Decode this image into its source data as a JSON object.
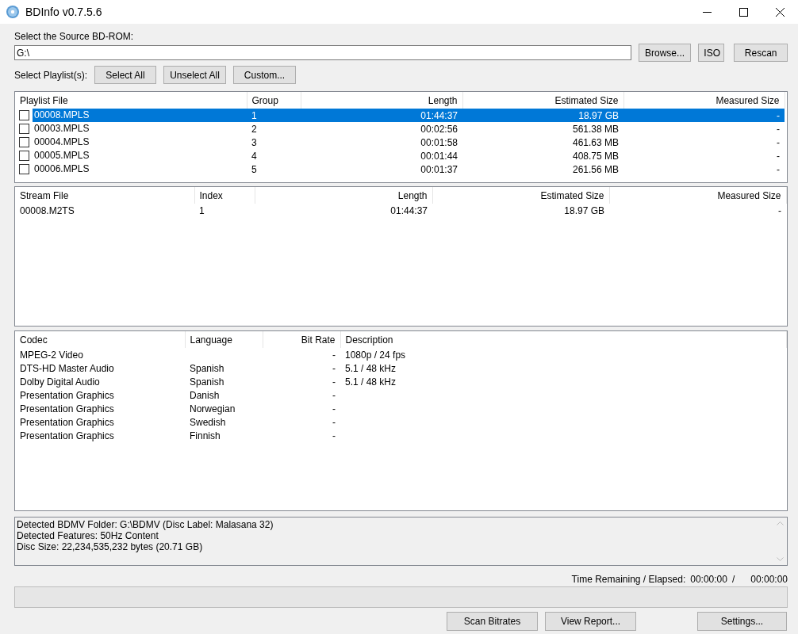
{
  "window": {
    "title": "BDInfo v0.7.5.6"
  },
  "source": {
    "label": "Select the Source BD-ROM:",
    "value": "G:\\",
    "buttons": [
      "Browse...",
      "ISO",
      "Rescan"
    ]
  },
  "playlist_select": {
    "label": "Select Playlist(s):",
    "buttons": [
      "Select All",
      "Unselect All",
      "Custom..."
    ]
  },
  "playlists": {
    "columns": [
      "Playlist File",
      "Group",
      "Length",
      "Estimated Size",
      "Measured Size"
    ],
    "rows": [
      {
        "cells": [
          "00008.MPLS",
          "1",
          "01:44:37",
          "18.97 GB",
          "-"
        ],
        "checked": false,
        "selected": true
      },
      {
        "cells": [
          "00003.MPLS",
          "2",
          "00:02:56",
          "561.38 MB",
          "-"
        ],
        "checked": false,
        "selected": false
      },
      {
        "cells": [
          "00004.MPLS",
          "3",
          "00:01:58",
          "461.63 MB",
          "-"
        ],
        "checked": false,
        "selected": false
      },
      {
        "cells": [
          "00005.MPLS",
          "4",
          "00:01:44",
          "408.75 MB",
          "-"
        ],
        "checked": false,
        "selected": false
      },
      {
        "cells": [
          "00006.MPLS",
          "5",
          "00:01:37",
          "261.56 MB",
          "-"
        ],
        "checked": false,
        "selected": false
      }
    ]
  },
  "streams": {
    "columns": [
      "Stream File",
      "Index",
      "Length",
      "Estimated Size",
      "Measured Size"
    ],
    "rows": [
      {
        "cells": [
          "00008.M2TS",
          "1",
          "01:44:37",
          "18.97 GB",
          "-"
        ]
      }
    ]
  },
  "codecs": {
    "columns": [
      "Codec",
      "Language",
      "Bit Rate",
      "Description"
    ],
    "rows": [
      {
        "cells": [
          "MPEG-2 Video",
          "",
          "-",
          "1080p / 24 fps"
        ]
      },
      {
        "cells": [
          "DTS-HD Master Audio",
          "Spanish",
          "-",
          "5.1 / 48 kHz"
        ]
      },
      {
        "cells": [
          "Dolby Digital Audio",
          "Spanish",
          "-",
          "5.1 / 48 kHz"
        ]
      },
      {
        "cells": [
          "Presentation Graphics",
          "Danish",
          "-",
          ""
        ]
      },
      {
        "cells": [
          "Presentation Graphics",
          "Norwegian",
          "-",
          ""
        ]
      },
      {
        "cells": [
          "Presentation Graphics",
          "Swedish",
          "-",
          ""
        ]
      },
      {
        "cells": [
          "Presentation Graphics",
          "Finnish",
          "-",
          ""
        ]
      }
    ]
  },
  "log": {
    "lines": [
      "Detected BDMV Folder: G:\\BDMV (Disc Label: Malasana 32)",
      "Detected Features: 50Hz Content",
      "Disc Size: 22,234,535,232 bytes (20.71 GB)"
    ]
  },
  "time": {
    "label": "Time Remaining / Elapsed:",
    "remaining": "00:00:00",
    "separator": "/",
    "elapsed": "00:00:00"
  },
  "progress": {
    "level": 0
  },
  "buttons": [
    "Scan Bitrates",
    "View Report...",
    "Settings..."
  ]
}
